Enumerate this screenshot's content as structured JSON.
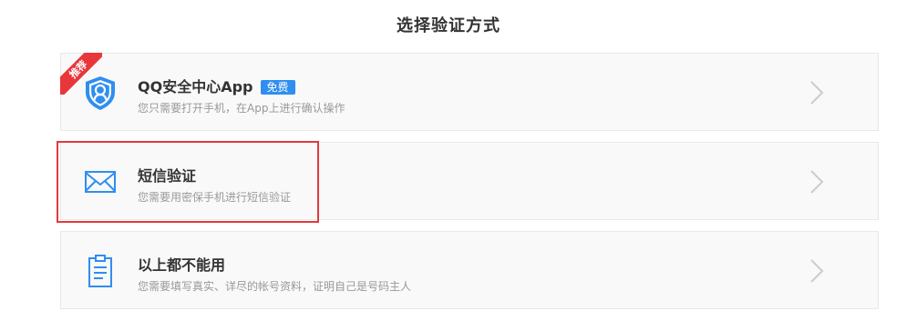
{
  "page": {
    "title": "选择验证方式"
  },
  "options": [
    {
      "title": "QQ安全中心App",
      "badge": "免费",
      "ribbon": "推荐",
      "description": "您只需要打开手机，在App上进行确认操作",
      "icon": "shield-user-icon"
    },
    {
      "title": "短信验证",
      "description": "您需要用密保手机进行短信验证",
      "icon": "envelope-icon"
    },
    {
      "title": "以上都不能用",
      "description": "您需要填写真实、详尽的帐号资料，证明自己是号码主人",
      "icon": "clipboard-icon"
    }
  ],
  "colors": {
    "accent_blue": "#2f8ef0",
    "ribbon_red": "#e8363b",
    "highlight_red": "#e03a3e",
    "card_bg": "#f9f9f9"
  }
}
